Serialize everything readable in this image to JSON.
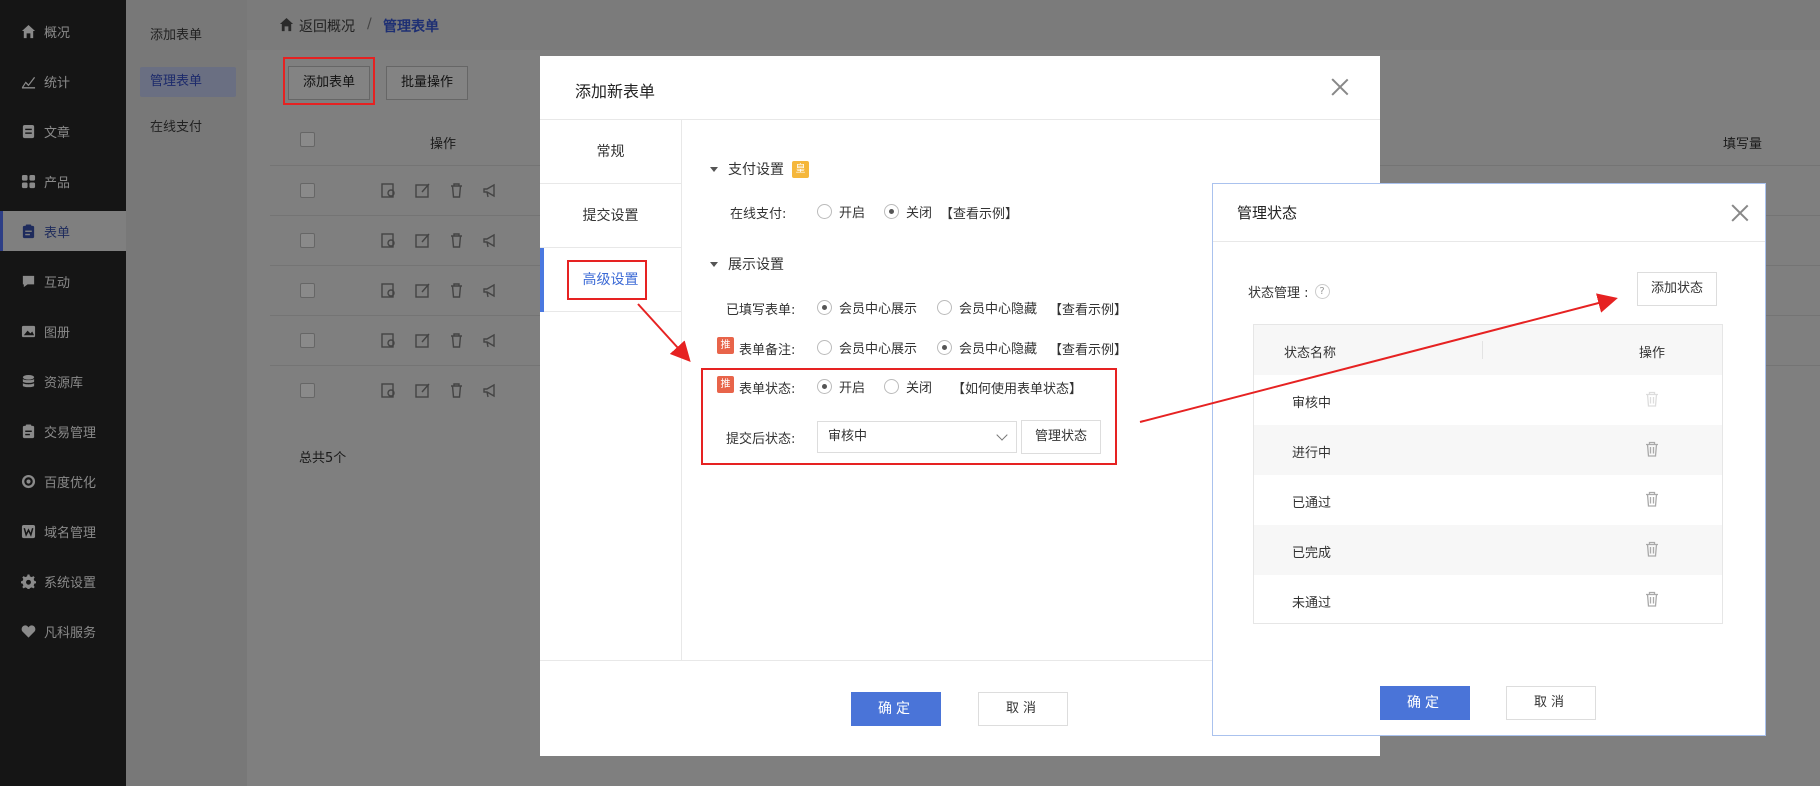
{
  "sidebar": {
    "items": [
      {
        "label": "概况",
        "icon": "home-icon"
      },
      {
        "label": "统计",
        "icon": "chart-icon"
      },
      {
        "label": "文章",
        "icon": "article-icon"
      },
      {
        "label": "产品",
        "icon": "grid-icon"
      },
      {
        "label": "表单",
        "icon": "form-icon"
      },
      {
        "label": "互动",
        "icon": "chat-icon"
      },
      {
        "label": "图册",
        "icon": "image-icon"
      },
      {
        "label": "资源库",
        "icon": "database-icon"
      },
      {
        "label": "交易管理",
        "icon": "clipboard-icon"
      },
      {
        "label": "百度优化",
        "icon": "target-icon"
      },
      {
        "label": "域名管理",
        "icon": "w-icon"
      },
      {
        "label": "系统设置",
        "icon": "gear-icon"
      },
      {
        "label": "凡科服务",
        "icon": "heart-icon"
      }
    ]
  },
  "subnav": {
    "items": [
      "添加表单",
      "管理表单",
      "在线支付"
    ]
  },
  "breadcrumb": {
    "back": "返回概况",
    "sep": "/",
    "current": "管理表单"
  },
  "list": {
    "add_btn": "添加表单",
    "batch_btn": "批量操作",
    "col_ops": "操作",
    "col_fill": "填写量",
    "total": "总共5个"
  },
  "dialog": {
    "title": "添加新表单",
    "tabs": [
      "常规",
      "提交设置",
      "高级设置"
    ],
    "pay_section": "支付设置",
    "vip": "皇",
    "online_pay_label": "在线支付:",
    "on": "开启",
    "off": "关闭",
    "example": "【查看示例】",
    "display_section": "展示设置",
    "filled_label": "已填写表单:",
    "member_show": "会员中心展示",
    "member_hide": "会员中心隐藏",
    "tui": "推",
    "remark_label": "表单备注:",
    "status_label": "表单状态:",
    "status_help": "【如何使用表单状态】",
    "after_submit_label": "提交后状态:",
    "after_submit_value": "审核中",
    "manage_status_btn": "管理状态",
    "ok": "确定",
    "cancel": "取消"
  },
  "status_dialog": {
    "title": "管理状态",
    "manage_label": "状态管理 :",
    "help": "?",
    "add_btn": "添加状态",
    "col_name": "状态名称",
    "col_ops": "操作",
    "rows": [
      "审核中",
      "进行中",
      "已通过",
      "已完成",
      "未通过"
    ],
    "ok": "确定",
    "cancel": "取消"
  },
  "colors": {
    "accent": "#4a74d8",
    "highlight": "#e62222",
    "vip": "#f5b73b",
    "tui": "#e8644a"
  }
}
